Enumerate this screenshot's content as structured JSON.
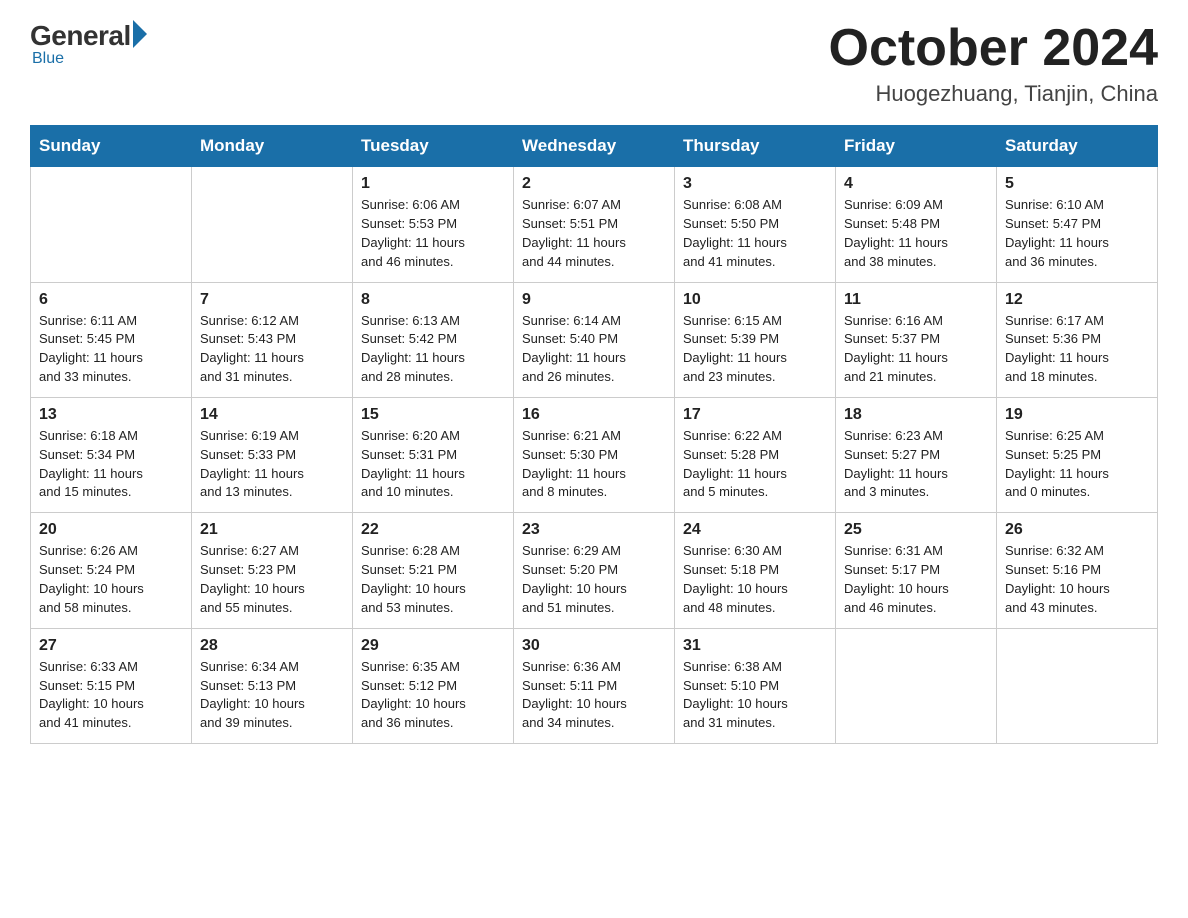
{
  "logo": {
    "general": "General",
    "blue": "Blue",
    "tagline": "Blue"
  },
  "header": {
    "month": "October 2024",
    "location": "Huogezhuang, Tianjin, China"
  },
  "days_of_week": [
    "Sunday",
    "Monday",
    "Tuesday",
    "Wednesday",
    "Thursday",
    "Friday",
    "Saturday"
  ],
  "weeks": [
    [
      {
        "day": "",
        "info": ""
      },
      {
        "day": "",
        "info": ""
      },
      {
        "day": "1",
        "info": "Sunrise: 6:06 AM\nSunset: 5:53 PM\nDaylight: 11 hours\nand 46 minutes."
      },
      {
        "day": "2",
        "info": "Sunrise: 6:07 AM\nSunset: 5:51 PM\nDaylight: 11 hours\nand 44 minutes."
      },
      {
        "day": "3",
        "info": "Sunrise: 6:08 AM\nSunset: 5:50 PM\nDaylight: 11 hours\nand 41 minutes."
      },
      {
        "day": "4",
        "info": "Sunrise: 6:09 AM\nSunset: 5:48 PM\nDaylight: 11 hours\nand 38 minutes."
      },
      {
        "day": "5",
        "info": "Sunrise: 6:10 AM\nSunset: 5:47 PM\nDaylight: 11 hours\nand 36 minutes."
      }
    ],
    [
      {
        "day": "6",
        "info": "Sunrise: 6:11 AM\nSunset: 5:45 PM\nDaylight: 11 hours\nand 33 minutes."
      },
      {
        "day": "7",
        "info": "Sunrise: 6:12 AM\nSunset: 5:43 PM\nDaylight: 11 hours\nand 31 minutes."
      },
      {
        "day": "8",
        "info": "Sunrise: 6:13 AM\nSunset: 5:42 PM\nDaylight: 11 hours\nand 28 minutes."
      },
      {
        "day": "9",
        "info": "Sunrise: 6:14 AM\nSunset: 5:40 PM\nDaylight: 11 hours\nand 26 minutes."
      },
      {
        "day": "10",
        "info": "Sunrise: 6:15 AM\nSunset: 5:39 PM\nDaylight: 11 hours\nand 23 minutes."
      },
      {
        "day": "11",
        "info": "Sunrise: 6:16 AM\nSunset: 5:37 PM\nDaylight: 11 hours\nand 21 minutes."
      },
      {
        "day": "12",
        "info": "Sunrise: 6:17 AM\nSunset: 5:36 PM\nDaylight: 11 hours\nand 18 minutes."
      }
    ],
    [
      {
        "day": "13",
        "info": "Sunrise: 6:18 AM\nSunset: 5:34 PM\nDaylight: 11 hours\nand 15 minutes."
      },
      {
        "day": "14",
        "info": "Sunrise: 6:19 AM\nSunset: 5:33 PM\nDaylight: 11 hours\nand 13 minutes."
      },
      {
        "day": "15",
        "info": "Sunrise: 6:20 AM\nSunset: 5:31 PM\nDaylight: 11 hours\nand 10 minutes."
      },
      {
        "day": "16",
        "info": "Sunrise: 6:21 AM\nSunset: 5:30 PM\nDaylight: 11 hours\nand 8 minutes."
      },
      {
        "day": "17",
        "info": "Sunrise: 6:22 AM\nSunset: 5:28 PM\nDaylight: 11 hours\nand 5 minutes."
      },
      {
        "day": "18",
        "info": "Sunrise: 6:23 AM\nSunset: 5:27 PM\nDaylight: 11 hours\nand 3 minutes."
      },
      {
        "day": "19",
        "info": "Sunrise: 6:25 AM\nSunset: 5:25 PM\nDaylight: 11 hours\nand 0 minutes."
      }
    ],
    [
      {
        "day": "20",
        "info": "Sunrise: 6:26 AM\nSunset: 5:24 PM\nDaylight: 10 hours\nand 58 minutes."
      },
      {
        "day": "21",
        "info": "Sunrise: 6:27 AM\nSunset: 5:23 PM\nDaylight: 10 hours\nand 55 minutes."
      },
      {
        "day": "22",
        "info": "Sunrise: 6:28 AM\nSunset: 5:21 PM\nDaylight: 10 hours\nand 53 minutes."
      },
      {
        "day": "23",
        "info": "Sunrise: 6:29 AM\nSunset: 5:20 PM\nDaylight: 10 hours\nand 51 minutes."
      },
      {
        "day": "24",
        "info": "Sunrise: 6:30 AM\nSunset: 5:18 PM\nDaylight: 10 hours\nand 48 minutes."
      },
      {
        "day": "25",
        "info": "Sunrise: 6:31 AM\nSunset: 5:17 PM\nDaylight: 10 hours\nand 46 minutes."
      },
      {
        "day": "26",
        "info": "Sunrise: 6:32 AM\nSunset: 5:16 PM\nDaylight: 10 hours\nand 43 minutes."
      }
    ],
    [
      {
        "day": "27",
        "info": "Sunrise: 6:33 AM\nSunset: 5:15 PM\nDaylight: 10 hours\nand 41 minutes."
      },
      {
        "day": "28",
        "info": "Sunrise: 6:34 AM\nSunset: 5:13 PM\nDaylight: 10 hours\nand 39 minutes."
      },
      {
        "day": "29",
        "info": "Sunrise: 6:35 AM\nSunset: 5:12 PM\nDaylight: 10 hours\nand 36 minutes."
      },
      {
        "day": "30",
        "info": "Sunrise: 6:36 AM\nSunset: 5:11 PM\nDaylight: 10 hours\nand 34 minutes."
      },
      {
        "day": "31",
        "info": "Sunrise: 6:38 AM\nSunset: 5:10 PM\nDaylight: 10 hours\nand 31 minutes."
      },
      {
        "day": "",
        "info": ""
      },
      {
        "day": "",
        "info": ""
      }
    ]
  ]
}
